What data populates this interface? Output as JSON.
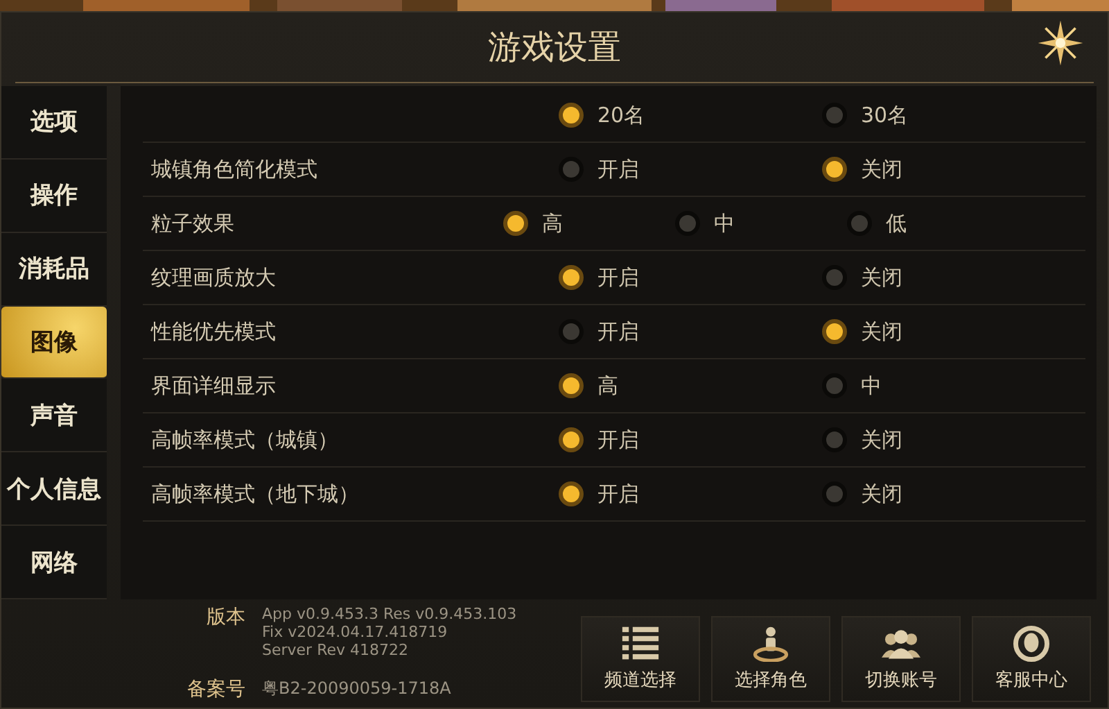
{
  "window": {
    "title": "游戏设置"
  },
  "sidebar": {
    "items": [
      {
        "label": "选项",
        "selected": false
      },
      {
        "label": "操作",
        "selected": false
      },
      {
        "label": "消耗品",
        "selected": false
      },
      {
        "label": "图像",
        "selected": true
      },
      {
        "label": "声音",
        "selected": false
      },
      {
        "label": "个人信息",
        "selected": false
      },
      {
        "label": "网络",
        "selected": false
      }
    ]
  },
  "settings": [
    {
      "options": [
        {
          "label": "20名",
          "selected": true
        },
        {
          "label": "30名",
          "selected": false
        }
      ]
    },
    {
      "label": "城镇角色简化模式",
      "options": [
        {
          "label": "开启",
          "selected": false
        },
        {
          "label": "关闭",
          "selected": true
        }
      ]
    },
    {
      "label": "粒子效果",
      "options": [
        {
          "label": "高",
          "selected": true
        },
        {
          "label": "中",
          "selected": false
        },
        {
          "label": "低",
          "selected": false
        }
      ]
    },
    {
      "label": "纹理画质放大",
      "options": [
        {
          "label": "开启",
          "selected": true
        },
        {
          "label": "关闭",
          "selected": false
        }
      ]
    },
    {
      "label": "性能优先模式",
      "options": [
        {
          "label": "开启",
          "selected": false
        },
        {
          "label": "关闭",
          "selected": true
        }
      ]
    },
    {
      "label": "界面详细显示",
      "options": [
        {
          "label": "高",
          "selected": true
        },
        {
          "label": "中",
          "selected": false
        }
      ]
    },
    {
      "label": "高帧率模式（城镇）",
      "options": [
        {
          "label": "开启",
          "selected": true
        },
        {
          "label": "关闭",
          "selected": false
        }
      ]
    },
    {
      "label": "高帧率模式（地下城）",
      "options": [
        {
          "label": "开启",
          "selected": true
        },
        {
          "label": "关闭",
          "selected": false
        }
      ]
    }
  ],
  "footer": {
    "version_label": "版本",
    "version_lines": [
      "App v0.9.453.3 Res v0.9.453.103",
      "Fix v2024.04.17.418719",
      "Server Rev 418722"
    ],
    "record_label": "备案号",
    "record": "粤B2-20090059-1718A"
  },
  "buttons": [
    {
      "kind": "list",
      "label": "频道选择"
    },
    {
      "kind": "character",
      "label": "选择角色"
    },
    {
      "kind": "group",
      "label": "切换账号"
    },
    {
      "kind": "support",
      "label": "客服中心"
    }
  ]
}
